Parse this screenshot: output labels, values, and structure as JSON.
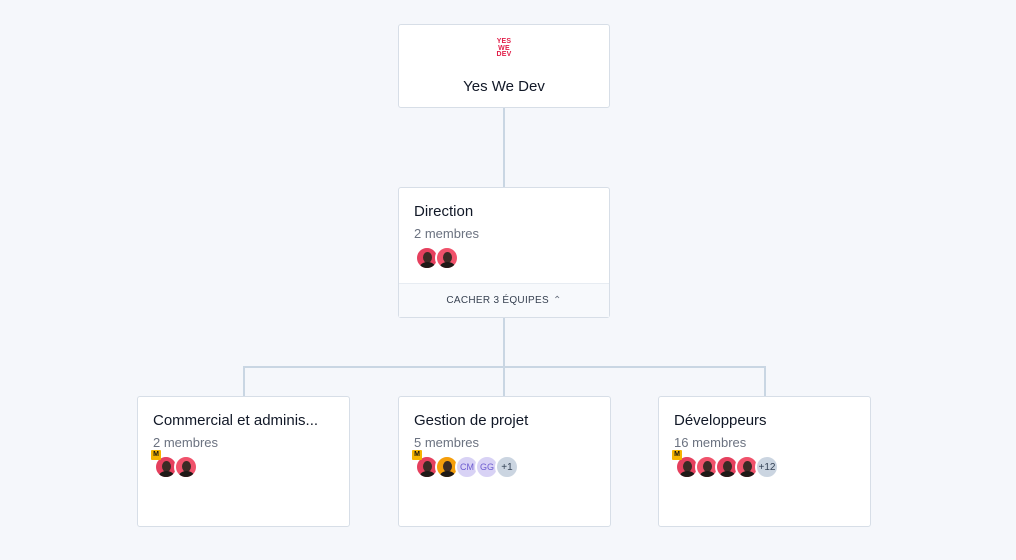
{
  "root": {
    "logo": "YES\nWE\nDEV",
    "title": "Yes We Dev"
  },
  "direction": {
    "title": "Direction",
    "members": "2 membres",
    "toggle_label": "CACHER 3 ÉQUIPES"
  },
  "teams": [
    {
      "title": "Commercial et adminis...",
      "members": "2 membres",
      "manager_badge": "M"
    },
    {
      "title": "Gestion de projet",
      "members": "5 membres",
      "manager_badge": "M",
      "initials": [
        "CM",
        "GG"
      ],
      "more": "+1"
    },
    {
      "title": "Développeurs",
      "members": "16 membres",
      "manager_badge": "M",
      "more": "+12"
    }
  ],
  "colors": {
    "brand": "#e11d48",
    "connector": "#c9d6e3",
    "manager_badge": "#f5b400"
  }
}
